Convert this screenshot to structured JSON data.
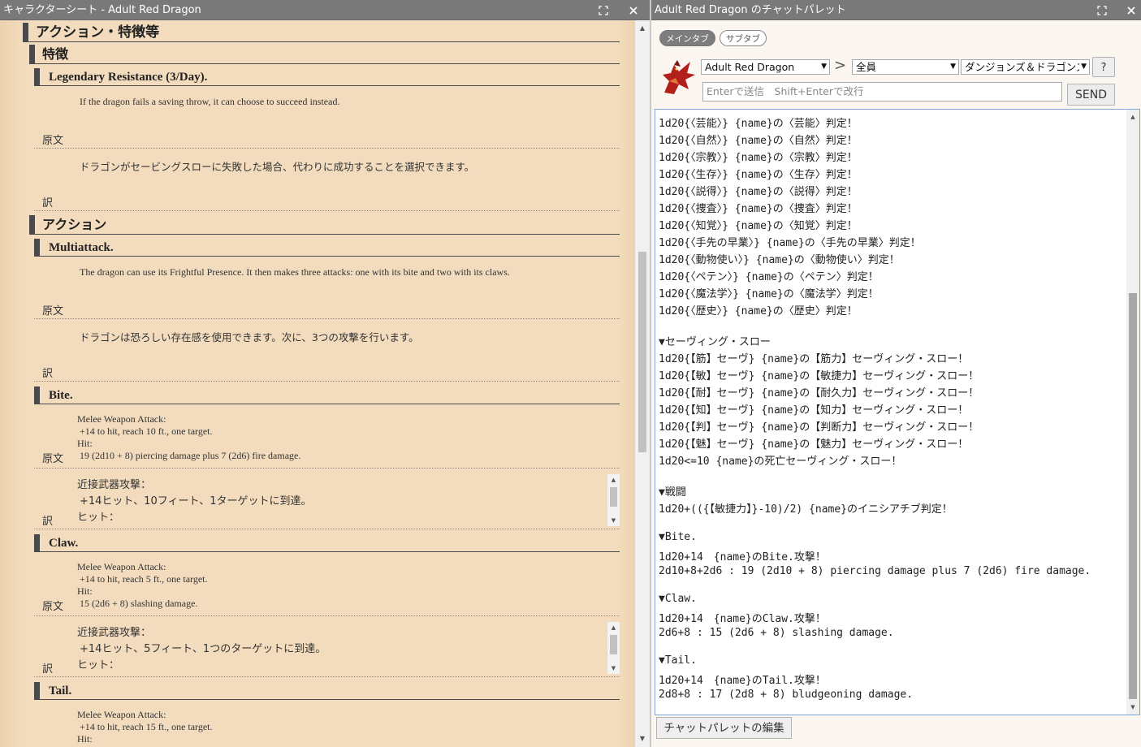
{
  "left": {
    "title": "キャラクターシート - Adult Red Dragon",
    "section_actions_traits": "アクション・特徴等",
    "traits_heading": "特徴",
    "legendary": {
      "name": "Legendary Resistance (3/Day).",
      "desc": "If the dragon fails a saving throw, it can choose to succeed instead.",
      "label_original": "原文",
      "translation": "ドラゴンがセービングスローに失敗した場合、代わりに成功することを選択できます。",
      "label_translation": "訳"
    },
    "actions_heading": "アクション",
    "multiattack": {
      "name": "Multiattack.",
      "desc": "The dragon can use its Frightful Presence. It then makes three attacks: one with its bite and two with its claws.",
      "label_original": "原文",
      "translation": "ドラゴンは恐ろしい存在感を使用できます。次に、3つの攻撃を行います。",
      "label_translation": "訳"
    },
    "bite": {
      "name": "Bite.",
      "l1": "Melee Weapon Attack:",
      "l2": "+14 to hit, reach 10 ft., one target.",
      "l3": "Hit:",
      "l4": "19 (2d10 + 8) piercing damage plus 7 (2d6) fire damage.",
      "label_original": "原文",
      "t1": "近接武器攻撃：",
      "t2": "+14ヒット、10フィート、1ターゲットに到達。",
      "t3": "ヒット：",
      "label_translation": "訳"
    },
    "claw": {
      "name": "Claw.",
      "l1": "Melee Weapon Attack:",
      "l2": "+14 to hit, reach 5 ft., one target.",
      "l3": "Hit:",
      "l4": "15 (2d6 + 8) slashing damage.",
      "label_original": "原文",
      "t1": "近接武器攻撃：",
      "t2": "+14ヒット、5フィート、1つのターゲットに到達。",
      "t3": "ヒット：",
      "label_translation": "訳"
    },
    "tail": {
      "name": "Tail.",
      "l1": "Melee Weapon Attack:",
      "l2": "+14 to hit, reach 15 ft., one target.",
      "l3": "Hit:"
    }
  },
  "right": {
    "title": "Adult Red Dragon のチャットパレット",
    "tab_main": "メインタブ",
    "tab_sub": "サブタブ",
    "character_select": "Adult Red Dragon",
    "arrow": ">",
    "target_select": "全員",
    "system_select": "ダンジョンズ＆ドラゴンズ",
    "help": "?",
    "chat_placeholder": "Enterで送信　Shift+Enterで改行",
    "send": "SEND",
    "edit_palette": "チャットパレットの編集",
    "palette_lines": [
      "1d20{〈芸能〉} {name}の〈芸能〉判定！",
      "1d20{〈自然〉} {name}の〈自然〉判定！",
      "1d20{〈宗教〉} {name}の〈宗教〉判定！",
      "1d20{〈生存〉} {name}の〈生存〉判定！",
      "1d20{〈説得〉} {name}の〈説得〉判定！",
      "1d20{〈捜査〉} {name}の〈捜査〉判定！",
      "1d20{〈知覚〉} {name}の〈知覚〉判定！",
      "1d20{〈手先の早業〉} {name}の〈手先の早業〉判定！",
      "1d20{〈動物使い〉} {name}の〈動物使い〉判定！",
      "1d20{〈ペテン〉} {name}の〈ペテン〉判定！",
      "1d20{〈魔法学〉} {name}の〈魔法学〉判定！",
      "1d20{〈歴史〉} {name}の〈歴史〉判定！",
      "▼セーヴィング・スロー",
      "1d20{【筋】セーヴ} {name}の【筋力】セーヴィング・スロー！",
      "1d20{【敏】セーヴ} {name}の【敏捷力】セーヴィング・スロー！",
      "1d20{【耐】セーヴ} {name}の【耐久力】セーヴィング・スロー！",
      "1d20{【知】セーヴ} {name}の【知力】セーヴィング・スロー！",
      "1d20{【判】セーヴ} {name}の【判断力】セーヴィング・スロー！",
      "1d20{【魅】セーヴ} {name}の【魅力】セーヴィング・スロー！",
      "1d20<=10 {name}の死亡セーヴィング・スロー！",
      "▼戦闘",
      "1d20+(({【敏捷力】}-10)/2) {name}のイニシアチブ判定！",
      "▼Bite.",
      "1d20+14　{name}のBite.攻撃！",
      "2d10+8+2d6 : 19 (2d10 + 8) piercing damage plus 7 (2d6) fire damage.",
      "▼Claw.",
      "1d20+14　{name}のClaw.攻撃！",
      "2d6+8 : 15 (2d6 + 8) slashing damage.",
      "▼Tail.",
      "1d20+14　{name}のTail.攻撃！",
      "2d8+8 : 17 (2d8 + 8) bludgeoning damage."
    ]
  }
}
